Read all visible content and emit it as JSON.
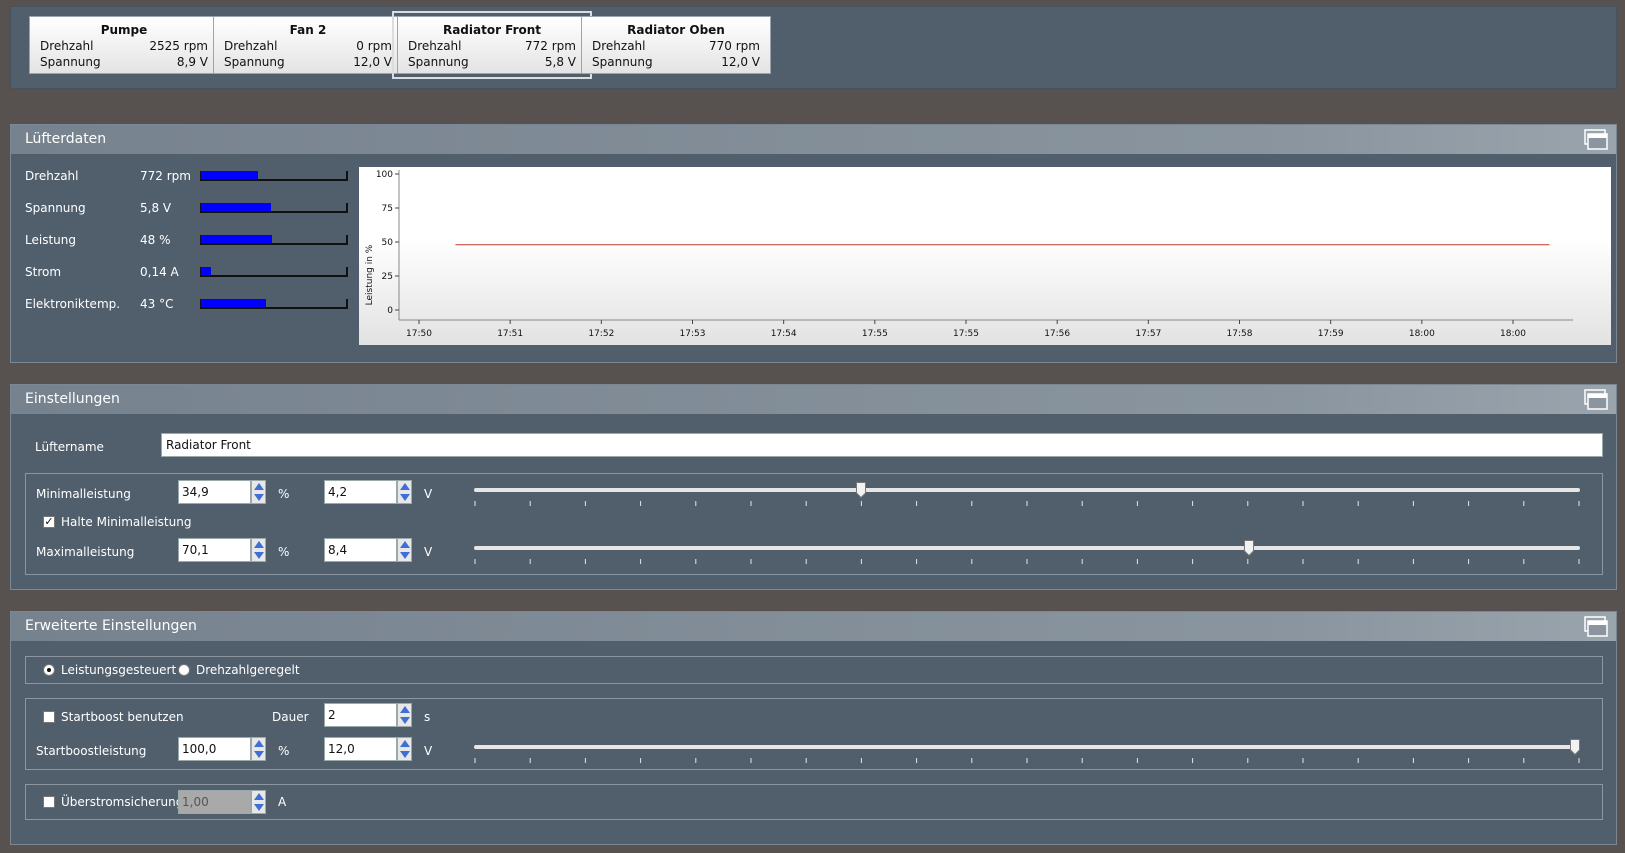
{
  "fans": [
    {
      "name": "Pumpe",
      "speed_label": "Drehzahl",
      "speed": "2525 rpm",
      "voltage_label": "Spannung",
      "voltage": "8,9 V",
      "selected": false
    },
    {
      "name": "Fan 2",
      "speed_label": "Drehzahl",
      "speed": "0 rpm",
      "voltage_label": "Spannung",
      "voltage": "12,0 V",
      "selected": false
    },
    {
      "name": "Radiator Front",
      "speed_label": "Drehzahl",
      "speed": "772 rpm",
      "voltage_label": "Spannung",
      "voltage": "5,8 V",
      "selected": true
    },
    {
      "name": "Radiator Oben",
      "speed_label": "Drehzahl",
      "speed": "770 rpm",
      "voltage_label": "Spannung",
      "voltage": "12,0 V",
      "selected": false
    }
  ],
  "fan_data": {
    "title": "Lüfterdaten",
    "rows": [
      {
        "label": "Drehzahl",
        "value": "772 rpm",
        "level": 0.39
      },
      {
        "label": "Spannung",
        "value": "5,8 V",
        "level": 0.48
      },
      {
        "label": "Leistung",
        "value": "48 %",
        "level": 0.49
      },
      {
        "label": "Strom",
        "value": "0,14 A",
        "level": 0.07
      },
      {
        "label": "Elektroniktemp.",
        "value": "43 °C",
        "level": 0.45
      }
    ]
  },
  "chart_data": {
    "type": "line",
    "ylabel": "Leistung in %",
    "xlabel": "",
    "ylim": [
      0,
      100
    ],
    "yticks": [
      "0",
      "25",
      "50",
      "75",
      "100"
    ],
    "xticks": [
      "17:50",
      "17:51",
      "17:52",
      "17:53",
      "17:54",
      "17:55",
      "17:55",
      "17:56",
      "17:57",
      "17:58",
      "17:59",
      "18:00",
      "18:00"
    ],
    "series": [
      {
        "color": "#c0392b",
        "x_range_ticks": [
          0.4,
          12.4
        ],
        "values": [
          48,
          48
        ]
      }
    ],
    "grid": false
  },
  "settings": {
    "title": "Einstellungen",
    "fan_name_label": "Lüftername",
    "fan_name": "Radiator Front",
    "min_label": "Minimalleistung",
    "min_percent": "34,9",
    "min_voltage": "4,2",
    "hold_min_label": "Halte Minimalleistung",
    "hold_min_checked": true,
    "max_label": "Maximalleistung",
    "max_percent": "70,1",
    "max_voltage": "8,4",
    "percent_unit": "%",
    "voltage_unit": "V",
    "min_slider_level": 0.35,
    "max_slider_level": 0.701
  },
  "advanced": {
    "title": "Erweiterte Einstellungen",
    "mode_power_label": "Leistungsgesteuert",
    "mode_speed_label": "Drehzahlgeregelt",
    "mode_power_selected": true,
    "startboost_label": "Startboost benutzen",
    "startboost_checked": false,
    "duration_label": "Dauer",
    "duration": "2",
    "duration_unit": "s",
    "startboost_power_label": "Startboostleistung",
    "startboost_percent": "100,0",
    "startboost_voltage": "12,0",
    "percent_unit": "%",
    "voltage_unit": "V",
    "startboost_slider_level": 1.0,
    "overcurrent_label": "Überstromsicherung",
    "overcurrent_checked": false,
    "overcurrent_value": "1,00",
    "overcurrent_unit": "A"
  },
  "colors": {
    "bar_fill": "#0000ff",
    "chart_line": "#c0392b",
    "panel_bg": "#515f6d"
  }
}
